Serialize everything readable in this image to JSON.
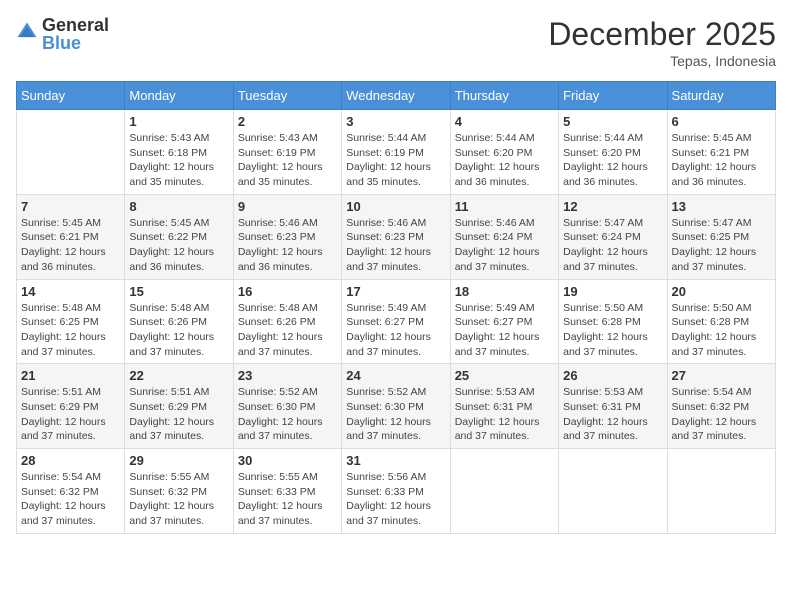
{
  "header": {
    "logo_general": "General",
    "logo_blue": "Blue",
    "title": "December 2025",
    "location": "Tepas, Indonesia"
  },
  "days_of_week": [
    "Sunday",
    "Monday",
    "Tuesday",
    "Wednesday",
    "Thursday",
    "Friday",
    "Saturday"
  ],
  "weeks": [
    {
      "stripe": "white",
      "days": [
        {
          "num": "",
          "info": ""
        },
        {
          "num": "1",
          "info": "Sunrise: 5:43 AM\nSunset: 6:18 PM\nDaylight: 12 hours and 35 minutes."
        },
        {
          "num": "2",
          "info": "Sunrise: 5:43 AM\nSunset: 6:19 PM\nDaylight: 12 hours and 35 minutes."
        },
        {
          "num": "3",
          "info": "Sunrise: 5:44 AM\nSunset: 6:19 PM\nDaylight: 12 hours and 35 minutes."
        },
        {
          "num": "4",
          "info": "Sunrise: 5:44 AM\nSunset: 6:20 PM\nDaylight: 12 hours and 36 minutes."
        },
        {
          "num": "5",
          "info": "Sunrise: 5:44 AM\nSunset: 6:20 PM\nDaylight: 12 hours and 36 minutes."
        },
        {
          "num": "6",
          "info": "Sunrise: 5:45 AM\nSunset: 6:21 PM\nDaylight: 12 hours and 36 minutes."
        }
      ]
    },
    {
      "stripe": "stripe",
      "days": [
        {
          "num": "7",
          "info": "Sunrise: 5:45 AM\nSunset: 6:21 PM\nDaylight: 12 hours and 36 minutes."
        },
        {
          "num": "8",
          "info": "Sunrise: 5:45 AM\nSunset: 6:22 PM\nDaylight: 12 hours and 36 minutes."
        },
        {
          "num": "9",
          "info": "Sunrise: 5:46 AM\nSunset: 6:23 PM\nDaylight: 12 hours and 36 minutes."
        },
        {
          "num": "10",
          "info": "Sunrise: 5:46 AM\nSunset: 6:23 PM\nDaylight: 12 hours and 37 minutes."
        },
        {
          "num": "11",
          "info": "Sunrise: 5:46 AM\nSunset: 6:24 PM\nDaylight: 12 hours and 37 minutes."
        },
        {
          "num": "12",
          "info": "Sunrise: 5:47 AM\nSunset: 6:24 PM\nDaylight: 12 hours and 37 minutes."
        },
        {
          "num": "13",
          "info": "Sunrise: 5:47 AM\nSunset: 6:25 PM\nDaylight: 12 hours and 37 minutes."
        }
      ]
    },
    {
      "stripe": "white",
      "days": [
        {
          "num": "14",
          "info": "Sunrise: 5:48 AM\nSunset: 6:25 PM\nDaylight: 12 hours and 37 minutes."
        },
        {
          "num": "15",
          "info": "Sunrise: 5:48 AM\nSunset: 6:26 PM\nDaylight: 12 hours and 37 minutes."
        },
        {
          "num": "16",
          "info": "Sunrise: 5:48 AM\nSunset: 6:26 PM\nDaylight: 12 hours and 37 minutes."
        },
        {
          "num": "17",
          "info": "Sunrise: 5:49 AM\nSunset: 6:27 PM\nDaylight: 12 hours and 37 minutes."
        },
        {
          "num": "18",
          "info": "Sunrise: 5:49 AM\nSunset: 6:27 PM\nDaylight: 12 hours and 37 minutes."
        },
        {
          "num": "19",
          "info": "Sunrise: 5:50 AM\nSunset: 6:28 PM\nDaylight: 12 hours and 37 minutes."
        },
        {
          "num": "20",
          "info": "Sunrise: 5:50 AM\nSunset: 6:28 PM\nDaylight: 12 hours and 37 minutes."
        }
      ]
    },
    {
      "stripe": "stripe",
      "days": [
        {
          "num": "21",
          "info": "Sunrise: 5:51 AM\nSunset: 6:29 PM\nDaylight: 12 hours and 37 minutes."
        },
        {
          "num": "22",
          "info": "Sunrise: 5:51 AM\nSunset: 6:29 PM\nDaylight: 12 hours and 37 minutes."
        },
        {
          "num": "23",
          "info": "Sunrise: 5:52 AM\nSunset: 6:30 PM\nDaylight: 12 hours and 37 minutes."
        },
        {
          "num": "24",
          "info": "Sunrise: 5:52 AM\nSunset: 6:30 PM\nDaylight: 12 hours and 37 minutes."
        },
        {
          "num": "25",
          "info": "Sunrise: 5:53 AM\nSunset: 6:31 PM\nDaylight: 12 hours and 37 minutes."
        },
        {
          "num": "26",
          "info": "Sunrise: 5:53 AM\nSunset: 6:31 PM\nDaylight: 12 hours and 37 minutes."
        },
        {
          "num": "27",
          "info": "Sunrise: 5:54 AM\nSunset: 6:32 PM\nDaylight: 12 hours and 37 minutes."
        }
      ]
    },
    {
      "stripe": "white",
      "days": [
        {
          "num": "28",
          "info": "Sunrise: 5:54 AM\nSunset: 6:32 PM\nDaylight: 12 hours and 37 minutes."
        },
        {
          "num": "29",
          "info": "Sunrise: 5:55 AM\nSunset: 6:32 PM\nDaylight: 12 hours and 37 minutes."
        },
        {
          "num": "30",
          "info": "Sunrise: 5:55 AM\nSunset: 6:33 PM\nDaylight: 12 hours and 37 minutes."
        },
        {
          "num": "31",
          "info": "Sunrise: 5:56 AM\nSunset: 6:33 PM\nDaylight: 12 hours and 37 minutes."
        },
        {
          "num": "",
          "info": ""
        },
        {
          "num": "",
          "info": ""
        },
        {
          "num": "",
          "info": ""
        }
      ]
    }
  ]
}
